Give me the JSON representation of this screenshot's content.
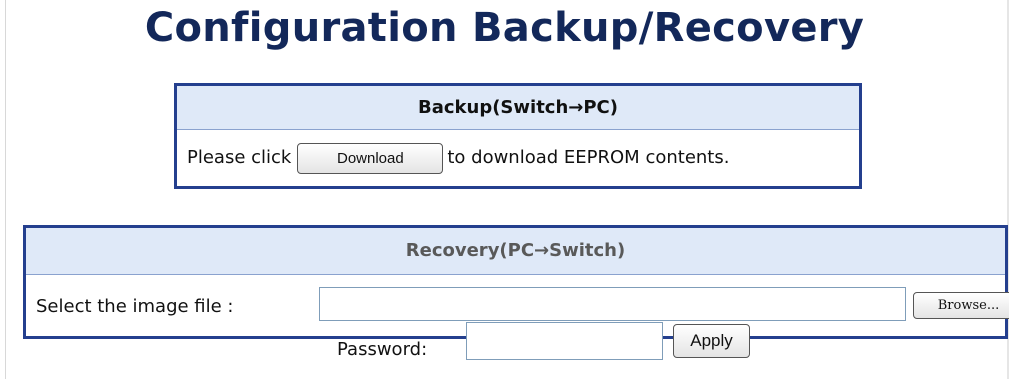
{
  "page": {
    "title": "Configuration Backup/Recovery"
  },
  "backup": {
    "header": "Backup(Switch→PC)",
    "text_before": "Please click",
    "button_label": "Download",
    "text_after": "to download EEPROM contents."
  },
  "recovery": {
    "header": "Recovery(PC→Switch)",
    "file_label": "Select the image file :",
    "file_value": "",
    "browse_label": "Browse...",
    "password_label": "Password:",
    "password_value": "",
    "apply_label": "Apply"
  },
  "colors": {
    "title": "#13285a",
    "panel_border": "#243f8e",
    "header_bg": "#dfe9f8",
    "header_text": "#595959"
  }
}
